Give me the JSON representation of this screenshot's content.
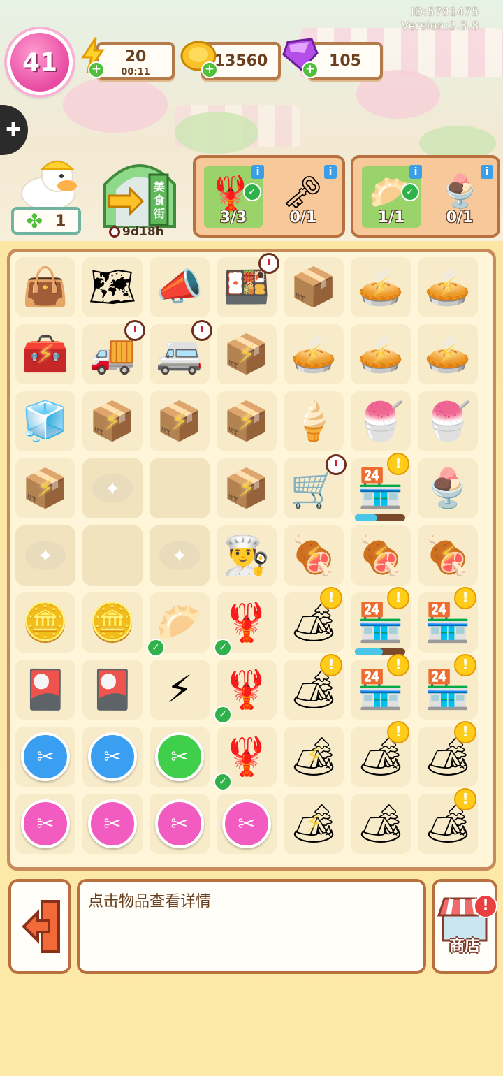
{
  "header": {
    "player_id": "ID:5791475",
    "version": "Version:2.3.8",
    "level": "41",
    "energy": {
      "value": "20",
      "timer": "00:11",
      "icon": "lightning-icon"
    },
    "coins": {
      "value": "13560",
      "icon": "coin-icon"
    },
    "gems": {
      "value": "105",
      "icon": "gem-icon"
    },
    "clovers": {
      "value": "1"
    },
    "gate": {
      "sign": "美食街",
      "timer": "9d18h"
    }
  },
  "orders": [
    {
      "items": [
        {
          "icon": "crayfish-icon",
          "progress": "3/3",
          "done": true
        },
        {
          "icon": "duck-key-icon",
          "progress": "0/1",
          "done": false
        }
      ]
    },
    {
      "items": [
        {
          "icon": "dumpling-icon",
          "progress": "1/1",
          "done": true
        },
        {
          "icon": "sundae-icon",
          "progress": "0/1",
          "done": false
        }
      ]
    }
  ],
  "board": {
    "rows": [
      [
        "bag",
        "map",
        "megaphone",
        "lunchbox",
        "lunchbox-empty",
        "pie",
        "pie"
      ],
      [
        "toaster",
        "truck",
        "food-truck",
        "cart",
        "pie",
        "pie",
        "pie"
      ],
      [
        "fridge",
        "cart",
        "cart",
        "cart",
        "icecream",
        "smoothie",
        "shaved-ice"
      ],
      [
        "cart",
        "locked",
        "empty",
        "cart",
        "bike-cart",
        "stall",
        "parfait"
      ],
      [
        "locked",
        "empty",
        "locked",
        "chef-hat",
        "grill",
        "grill",
        "grill"
      ],
      [
        "coins",
        "coins",
        "dumpling",
        "crayfish",
        "grill-cart",
        "stall",
        "stall"
      ],
      [
        "card",
        "card",
        "energy-orb",
        "crayfish",
        "grill-cart",
        "stall",
        "stall"
      ],
      [
        "scissors-blue",
        "scissors-blue",
        "scissors-green",
        "crayfish",
        "grill-cart",
        "grill-cart",
        "grill-cart"
      ],
      [
        "scissors-pink",
        "scissors-pink",
        "scissors-pink",
        "scissors-pink",
        "grill-cart",
        "grill-cart",
        "grill-cart"
      ]
    ]
  },
  "detail_text": "点击物品查看详情",
  "shop_label": "商店",
  "colors": {
    "accent": "#b8703f",
    "board_bg": "#fff6da",
    "level": "#e84aa3"
  }
}
